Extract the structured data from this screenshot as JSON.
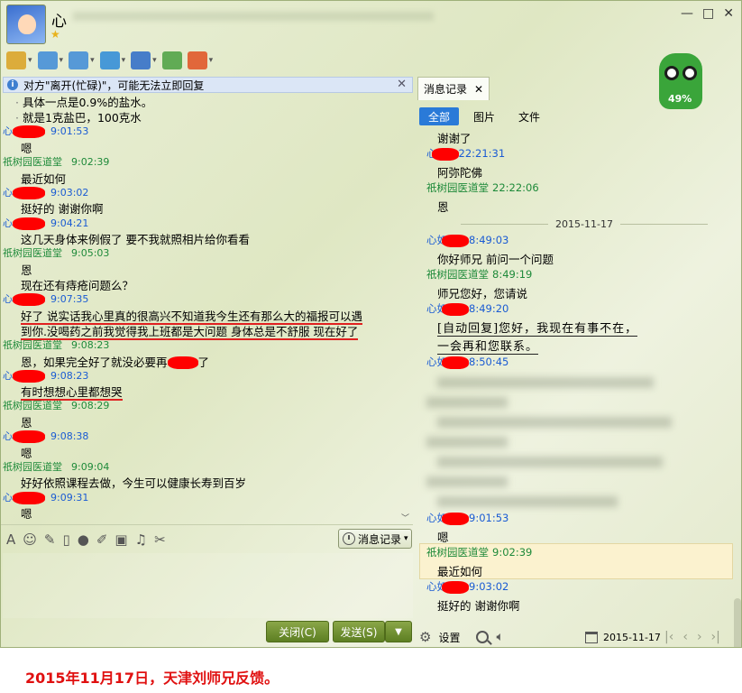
{
  "window": {
    "title_name": "心",
    "controls": [
      "—",
      "□",
      "✕"
    ]
  },
  "toolbar": {
    "items": [
      {
        "name": "voice-call-icon",
        "color": "#d9a020"
      },
      {
        "name": "video-call-icon",
        "color": "#3c8ad8"
      },
      {
        "name": "remote-desktop-icon",
        "color": "#3c8ad8"
      },
      {
        "name": "file-transfer-icon",
        "color": "#2a8ad8"
      },
      {
        "name": "screen-share-icon",
        "color": "#2a6ac8"
      },
      {
        "name": "add-contact-icon",
        "color": "#4aa040"
      },
      {
        "name": "apps-icon",
        "color": "#e05020"
      }
    ]
  },
  "mascot": {
    "percent": "49%"
  },
  "notice": {
    "text": "对方\"离开(忙碌)\"，可能无法立即回复"
  },
  "chat": {
    "lines": [
      {
        "kind": "msg",
        "text": "具体一点是0.9%的盐水。"
      },
      {
        "kind": "msg",
        "text": "就是1克盐巴，100克水"
      },
      {
        "kind": "hdr-me",
        "prefix": "心",
        "time": "9:01:53"
      },
      {
        "kind": "msg",
        "text": "嗯"
      },
      {
        "kind": "hdr-other",
        "name": "祇树园医道堂",
        "time": "9:02:39"
      },
      {
        "kind": "msg",
        "text": "最近如何"
      },
      {
        "kind": "hdr-me",
        "prefix": "心",
        "time": "9:03:02"
      },
      {
        "kind": "msg",
        "text": "挺好的  谢谢你啊"
      },
      {
        "kind": "hdr-me",
        "prefix": "心",
        "time": "9:04:21"
      },
      {
        "kind": "msg",
        "text": "这几天身体来例假了   要不我就照相片给你看看"
      },
      {
        "kind": "hdr-other",
        "name": "祇树园医道堂",
        "time": "9:05:03"
      },
      {
        "kind": "msg",
        "text": "恩"
      },
      {
        "kind": "msg",
        "text": "现在还有痔疮问题么？"
      },
      {
        "kind": "hdr-me",
        "prefix": "心",
        "time": "9:07:35"
      },
      {
        "kind": "msg-ul",
        "text": "好了     说实话我心里真的很高兴不知道我今生还有那么大的福报可以遇"
      },
      {
        "kind": "msg-ul",
        "text": "到你.没喝药之前我觉得我上班都是大问题   身体总是不舒服     现在好了"
      },
      {
        "kind": "hdr-other",
        "name": "祇树园医道堂",
        "time": "9:08:23"
      },
      {
        "kind": "msg",
        "text": "恩，如果完全好了就没必要再",
        "suffix": "了"
      },
      {
        "kind": "hdr-me",
        "prefix": "心",
        "time": "9:08:23"
      },
      {
        "kind": "msg-ul",
        "text": "有时想想心里都想哭"
      },
      {
        "kind": "hdr-other",
        "name": "祇树园医道堂",
        "time": "9:08:29"
      },
      {
        "kind": "msg",
        "text": "恩"
      },
      {
        "kind": "hdr-me",
        "prefix": "心",
        "time": "9:08:38"
      },
      {
        "kind": "msg",
        "text": "嗯"
      },
      {
        "kind": "hdr-other",
        "name": "祇树园医道堂",
        "time": "9:09:04"
      },
      {
        "kind": "msg",
        "text": "好好依照课程去做，今生可以健康长寿到百岁"
      },
      {
        "kind": "hdr-me",
        "prefix": "心",
        "time": "9:09:31"
      },
      {
        "kind": "msg",
        "text": "嗯"
      }
    ]
  },
  "format_bar": {
    "history_label": "消息记录",
    "icons": [
      "font-icon",
      "emoji-icon",
      "shake-icon",
      "screenshot-icon",
      "mic-icon",
      "edit-icon",
      "image-icon",
      "music-icon",
      "scissors-icon"
    ]
  },
  "buttons": {
    "close": "关闭(C)",
    "send": "发送(S)"
  },
  "history": {
    "tab": "消息记录",
    "filters": [
      "全部",
      "图片",
      "文件"
    ],
    "lines": [
      {
        "kind": "msg",
        "text": "谢谢了"
      },
      {
        "kind": "hdr-me",
        "prefix": "心",
        "time": "22:21:31"
      },
      {
        "kind": "msg",
        "text": "阿弥陀佛"
      },
      {
        "kind": "hdr-other",
        "name": "祇树园医道堂",
        "time": "22:22:06"
      },
      {
        "kind": "msg",
        "text": "恩"
      },
      {
        "kind": "date",
        "text": "2015-11-17"
      },
      {
        "kind": "hdr-me",
        "prefix": "心如",
        "time": "8:49:03"
      },
      {
        "kind": "msg",
        "text": "你好师兄   前问一个问题"
      },
      {
        "kind": "hdr-other",
        "name": "祇树园医道堂",
        "time": "8:49:19"
      },
      {
        "kind": "msg",
        "text": "师兄您好，您请说"
      },
      {
        "kind": "hdr-me",
        "prefix": "心如",
        "time": "8:49:20"
      },
      {
        "kind": "auto",
        "text": "[自动回复]您好，我现在有事不在，"
      },
      {
        "kind": "auto",
        "text": "一会再和您联系。"
      },
      {
        "kind": "hdr-me",
        "prefix": "心如",
        "time": "8:50:45"
      },
      {
        "kind": "hdr-me",
        "prefix": "心如",
        "time": "9:01:53"
      },
      {
        "kind": "msg",
        "text": "嗯"
      },
      {
        "kind": "hdr-other",
        "name": "祇树园医道堂",
        "time": "9:02:39"
      },
      {
        "kind": "msg",
        "text": "最近如何"
      },
      {
        "kind": "hdr-me",
        "prefix": "心如",
        "time": "9:03:02"
      },
      {
        "kind": "msg",
        "text": "挺好的  谢谢你啊"
      }
    ],
    "footer": {
      "settings": "设置",
      "date": "2015-11-17"
    }
  },
  "caption": "2015年11月17日，天津刘师兄反馈。",
  "colors": {
    "me": "#1a5bd3",
    "other": "#1e8a3a",
    "redact": "#ff0000",
    "caption": "#e01010"
  }
}
